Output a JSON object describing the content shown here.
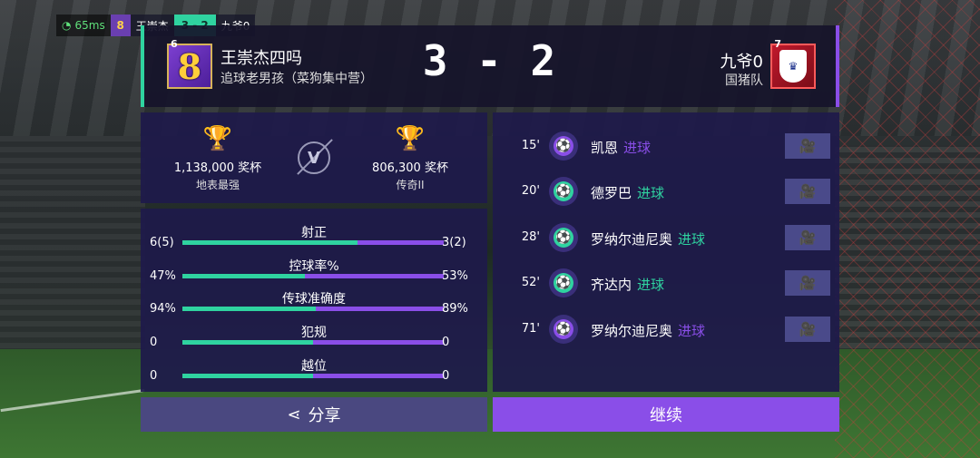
{
  "hud": {
    "ping": "65ms",
    "home_short": "王崇杰",
    "score": "3 - 2",
    "away_short": "九爷0"
  },
  "header": {
    "home": {
      "level": "6",
      "name": "王崇杰四吗",
      "club": "追球老男孩（菜狗集中营）",
      "badge_glyph": "8"
    },
    "score": "3 - 2",
    "away": {
      "level": "7",
      "name": "九爷0",
      "club": "国猪队",
      "badge_icon": "three-lions-shield-icon"
    }
  },
  "trophies": {
    "home": {
      "count": "1,138,000 奖杯",
      "league": "地表最强"
    },
    "vs": "V",
    "away": {
      "count": "806,300 奖杯",
      "league": "传奇II"
    }
  },
  "stats": [
    {
      "label": "射正",
      "home": "6(5)",
      "away": "3(2)",
      "home_share": 0.67
    },
    {
      "label": "控球率%",
      "home": "47%",
      "away": "53%",
      "home_share": 0.47
    },
    {
      "label": "传球准确度",
      "home": "94%",
      "away": "89%",
      "home_share": 0.51
    },
    {
      "label": "犯规",
      "home": "0",
      "away": "0",
      "home_share": 0.5
    },
    {
      "label": "越位",
      "home": "0",
      "away": "0",
      "home_share": 0.5
    }
  ],
  "events": [
    {
      "minute": "15'",
      "player": "凯恩",
      "word": "进球",
      "side": "away"
    },
    {
      "minute": "20'",
      "player": "德罗巴",
      "word": "进球",
      "side": "home"
    },
    {
      "minute": "28'",
      "player": "罗纳尔迪尼奥",
      "word": "进球",
      "side": "home"
    },
    {
      "minute": "52'",
      "player": "齐达内",
      "word": "进球",
      "side": "home"
    },
    {
      "minute": "71'",
      "player": "罗纳尔迪尼奥",
      "word": "进球",
      "side": "away"
    }
  ],
  "buttons": {
    "share": "分享",
    "continue": "继续"
  },
  "colors": {
    "home": "#2fd3a0",
    "away": "#8a4ee8",
    "panel": "#1e1a4a",
    "trophy": "#f4c430"
  }
}
